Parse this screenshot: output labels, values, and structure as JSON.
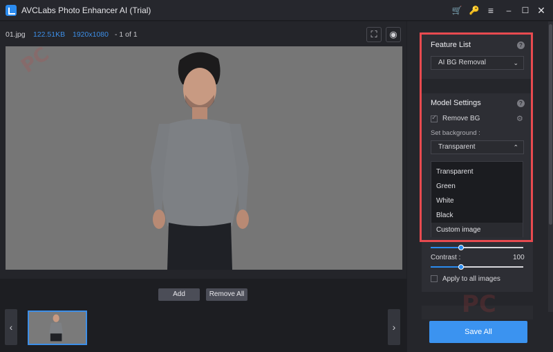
{
  "app": {
    "title": "AVCLabs Photo Enhancer AI (Trial)"
  },
  "titlebar": {
    "icons": [
      "cart-icon",
      "key-icon",
      "menu-icon",
      "minimize-icon",
      "maximize-icon",
      "close-icon"
    ],
    "glyphs": {
      "cart": "🛒",
      "key": "🔑",
      "menu": "≡",
      "min": "–",
      "max": "☐",
      "close": "✕"
    }
  },
  "image_info": {
    "filename": "01.jpg",
    "filesize": "122.51KB",
    "resolution": "1920x1080",
    "page": "- 1 of 1"
  },
  "toolbar": {
    "crop_glyph": "⛶",
    "eye_glyph": "◉"
  },
  "bottom": {
    "add_label": "Add",
    "remove_all_label": "Remove All",
    "prev_glyph": "‹",
    "next_glyph": "›"
  },
  "feature_list": {
    "title": "Feature List",
    "help_glyph": "?",
    "selected": "AI BG Removal",
    "caret": "⌄"
  },
  "model_settings": {
    "title": "Model Settings",
    "help_glyph": "?",
    "remove_bg_label": "Remove BG",
    "remove_bg_checked": true,
    "gear_glyph": "⚙",
    "set_background_label": "Set background :",
    "background_selected": "Transparent",
    "caret_up": "⌃",
    "background_options": [
      "Transparent",
      "Green",
      "White",
      "Black",
      "Custom image"
    ],
    "hovered_option": "Custom image",
    "brightness_level": 0.33,
    "contrast_label": "Contrast :",
    "contrast_value": "100",
    "contrast_level": 0.33,
    "apply_all_label": "Apply to all images",
    "apply_all_checked": false
  },
  "save_all_label": "Save All",
  "colors": {
    "accent": "#3b93f0",
    "highlight_border": "#e84a4f",
    "info_blue": "#3d8fe8",
    "titlebar_icon_gold": "#f5b400"
  }
}
